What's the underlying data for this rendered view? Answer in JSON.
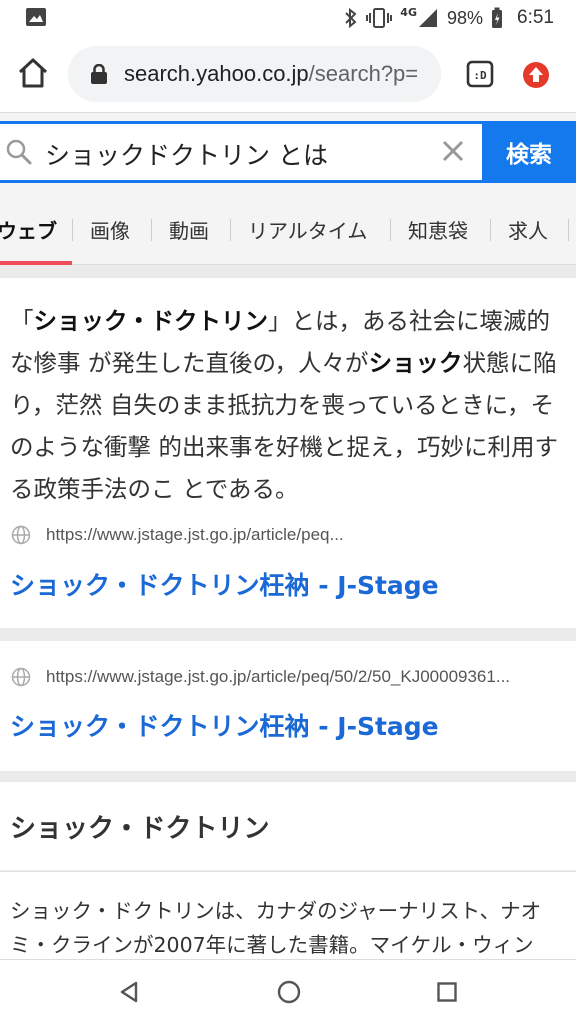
{
  "status": {
    "network": "4G",
    "battery": "98%",
    "time": "6:51"
  },
  "browser": {
    "url_host": "search.yahoo.co.jp",
    "url_path": "/search?p="
  },
  "search": {
    "query": "ショックドクトリン とは",
    "button_label": "検索"
  },
  "tabs": [
    {
      "label": "ウェブ"
    },
    {
      "label": "画像"
    },
    {
      "label": "動画"
    },
    {
      "label": "リアルタイム"
    },
    {
      "label": "知恵袋"
    },
    {
      "label": "求人"
    }
  ],
  "featured": {
    "open_quote": "「",
    "term": "ショック・ドクトリン",
    "part1": "」とは，ある社会に壊滅的な惨事 が発生した直後の，人々が",
    "term2": "ショック",
    "part2": "状態に陥り，茫然 自失のまま抵抗力を喪っているときに，そのような衝撃 的出来事を好機と捉え，巧妙に利用する政策手法のこ とである。",
    "source_url": "https://www.jstage.jst.go.jp/article/peq...",
    "link_title": "ショック・ドクトリン枉衲 - J-Stage"
  },
  "result2": {
    "url": "https://www.jstage.jst.go.jp/article/peq/50/2/50_KJ00009361...",
    "title": "ショック・ドクトリン枉衲 - J-Stage"
  },
  "knowledge": {
    "title": "ショック・ドクトリン",
    "description": "ショック・ドクトリンは、カナダのジャーナリスト、ナオミ・クラインが2007年に著した書籍。マイケル・ウィン"
  },
  "colors": {
    "accent": "#1479ec",
    "link": "#1b69d6",
    "active_tab": "#ee4c5b",
    "extension": "#e53a2a"
  }
}
